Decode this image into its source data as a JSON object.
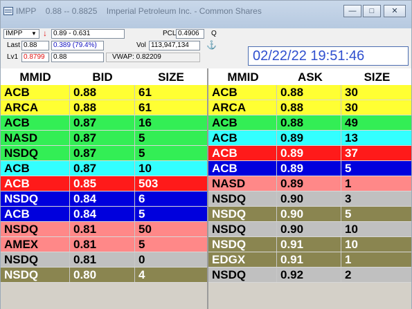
{
  "window": {
    "title_symbol": "IMPP",
    "title_range": "0.88 -- 0.8825",
    "title_name": "Imperial Petroleum Inc. - Common Shares",
    "btn_min": "—",
    "btn_max": "□",
    "btn_close": "✕"
  },
  "quote": {
    "symbol": "IMPP",
    "arrow": "↓",
    "range": "0.89 - 0.631",
    "pcl_label": "PCL",
    "pcl": "0.4906",
    "q_label": "Q",
    "last_label": "Last",
    "last": "0.88",
    "change": "0.389  (79.4%)",
    "vol_label": "Vol",
    "vol": "113,947,134",
    "anchor_glyph": "⚓",
    "lv1_label": "Lv1",
    "lv1": "0.8799",
    "lv1b": "0.88",
    "vwap": "VWAP: 0.82209",
    "clock": "02/22/22 19:51:46"
  },
  "colors": {
    "yellow": "#ffff33",
    "green": "#33ee55",
    "cyan": "#33ffff",
    "red": "#ff1a1a",
    "blue": "#0000dd",
    "pink": "#ff8888",
    "gray": "#c0c0c0",
    "olive": "#8a8550"
  },
  "bids": {
    "headers": [
      "MMID",
      "BID",
      "SIZE"
    ],
    "rows": [
      {
        "mmid": "ACB",
        "price": "0.88",
        "size": "61",
        "bg": "#ffff33",
        "fg": "#000000"
      },
      {
        "mmid": "ARCA",
        "price": "0.88",
        "size": "61",
        "bg": "#ffff33",
        "fg": "#000000"
      },
      {
        "mmid": "ACB",
        "price": "0.87",
        "size": "16",
        "bg": "#33ee55",
        "fg": "#000000"
      },
      {
        "mmid": "NASD",
        "price": "0.87",
        "size": "5",
        "bg": "#33ee55",
        "fg": "#000000"
      },
      {
        "mmid": "NSDQ",
        "price": "0.87",
        "size": "5",
        "bg": "#33ee55",
        "fg": "#000000"
      },
      {
        "mmid": "ACB",
        "price": "0.87",
        "size": "10",
        "bg": "#33ffff",
        "fg": "#000000"
      },
      {
        "mmid": "ACB",
        "price": "0.85",
        "size": "503",
        "bg": "#ff1a1a",
        "fg": "#ffffff"
      },
      {
        "mmid": "NSDQ",
        "price": "0.84",
        "size": "6",
        "bg": "#0000dd",
        "fg": "#ffffff"
      },
      {
        "mmid": "ACB",
        "price": "0.84",
        "size": "5",
        "bg": "#0000dd",
        "fg": "#ffffff"
      },
      {
        "mmid": "NSDQ",
        "price": "0.81",
        "size": "50",
        "bg": "#ff8888",
        "fg": "#000000"
      },
      {
        "mmid": "AMEX",
        "price": "0.81",
        "size": "5",
        "bg": "#ff8888",
        "fg": "#000000"
      },
      {
        "mmid": "NSDQ",
        "price": "0.81",
        "size": "0",
        "bg": "#c0c0c0",
        "fg": "#000000"
      },
      {
        "mmid": "NSDQ",
        "price": "0.80",
        "size": "4",
        "bg": "#8a8550",
        "fg": "#ffffff"
      }
    ]
  },
  "asks": {
    "headers": [
      "MMID",
      "ASK",
      "SIZE"
    ],
    "rows": [
      {
        "mmid": "ACB",
        "price": "0.88",
        "size": "30",
        "bg": "#ffff33",
        "fg": "#000000"
      },
      {
        "mmid": "ARCA",
        "price": "0.88",
        "size": "30",
        "bg": "#ffff33",
        "fg": "#000000"
      },
      {
        "mmid": "ACB",
        "price": "0.88",
        "size": "49",
        "bg": "#33ee55",
        "fg": "#000000"
      },
      {
        "mmid": "ACB",
        "price": "0.89",
        "size": "13",
        "bg": "#33ffff",
        "fg": "#000000"
      },
      {
        "mmid": "ACB",
        "price": "0.89",
        "size": "37",
        "bg": "#ff1a1a",
        "fg": "#ffffff"
      },
      {
        "mmid": "ACB",
        "price": "0.89",
        "size": "5",
        "bg": "#0000dd",
        "fg": "#ffffff"
      },
      {
        "mmid": "NASD",
        "price": "0.89",
        "size": "1",
        "bg": "#ff8888",
        "fg": "#000000"
      },
      {
        "mmid": "NSDQ",
        "price": "0.90",
        "size": "3",
        "bg": "#c0c0c0",
        "fg": "#000000"
      },
      {
        "mmid": "NSDQ",
        "price": "0.90",
        "size": "5",
        "bg": "#8a8550",
        "fg": "#ffffff"
      },
      {
        "mmid": "NSDQ",
        "price": "0.90",
        "size": "10",
        "bg": "#c0c0c0",
        "fg": "#000000"
      },
      {
        "mmid": "NSDQ",
        "price": "0.91",
        "size": "10",
        "bg": "#8a8550",
        "fg": "#ffffff"
      },
      {
        "mmid": "EDGX",
        "price": "0.91",
        "size": "1",
        "bg": "#8a8550",
        "fg": "#ffffff"
      },
      {
        "mmid": "NSDQ",
        "price": "0.92",
        "size": "2",
        "bg": "#c0c0c0",
        "fg": "#000000"
      }
    ]
  }
}
